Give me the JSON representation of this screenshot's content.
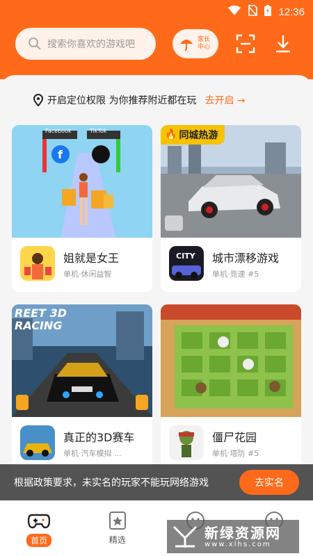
{
  "status_bar": {
    "time": "12:36"
  },
  "header": {
    "search_placeholder": "搜索你喜欢的游戏吧",
    "parent_center_label_line1": "家长",
    "parent_center_label_line2": "中心"
  },
  "location_banner": {
    "text": "开启定位权限 为你推荐附近都在玩",
    "action": "去开启"
  },
  "games": [
    {
      "name": "姐就是女王",
      "tags": "单机·休闲益智",
      "art_texts": [
        "Facebook",
        "TikTok"
      ]
    },
    {
      "name": "城市漂移游戏",
      "tags": "单机·竞速 #5",
      "badge": "同城热游",
      "icon_text": "CITY"
    },
    {
      "name": "真正的3D赛车",
      "tags": "单机·汽车模拟 ...",
      "art_text": "REET 3D RACING"
    },
    {
      "name": "僵尸花园",
      "tags": "单机·塔防 #5"
    }
  ],
  "toast": {
    "message": "根据政策要求，未实名的玩家不能玩网络游戏",
    "button": "去实名"
  },
  "tabbar": {
    "tabs": [
      {
        "label": "首页",
        "icon": "gamepad-icon"
      },
      {
        "label": "精选",
        "icon": "star-card-icon"
      },
      {
        "label": "",
        "icon": "face-icon"
      },
      {
        "label": "",
        "icon": "face-icon"
      }
    ]
  },
  "watermark": {
    "title": "新绿资源网",
    "sub": "www.xlhs.com"
  },
  "colors": {
    "brand": "#ff6a1a",
    "hot_badge": "#f7c200"
  }
}
